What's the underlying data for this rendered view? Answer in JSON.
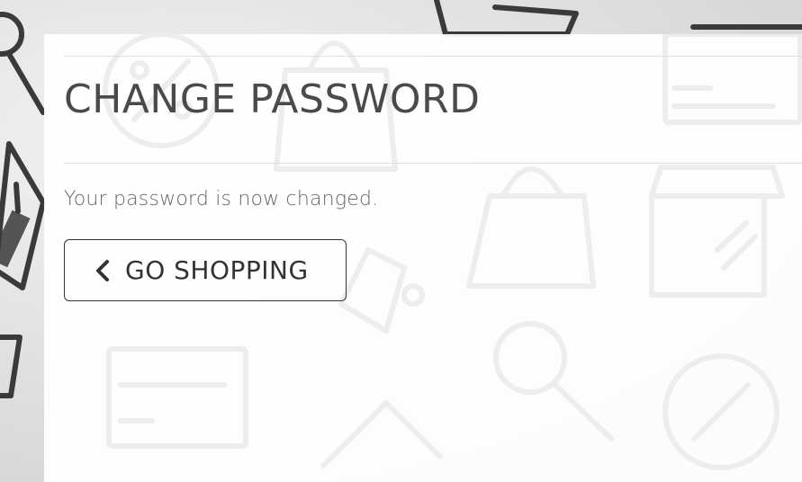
{
  "page": {
    "title": "CHANGE PASSWORD",
    "message": "Your password is now changed."
  },
  "actions": {
    "go_shopping_label": "GO SHOPPING",
    "go_shopping_icon": "chevron-left-icon"
  },
  "colors": {
    "panel_background": "#ffffff",
    "title_text": "#4a4a4a",
    "message_text": "#666666",
    "button_border": "#333333",
    "page_background": "#e9e9e9"
  }
}
